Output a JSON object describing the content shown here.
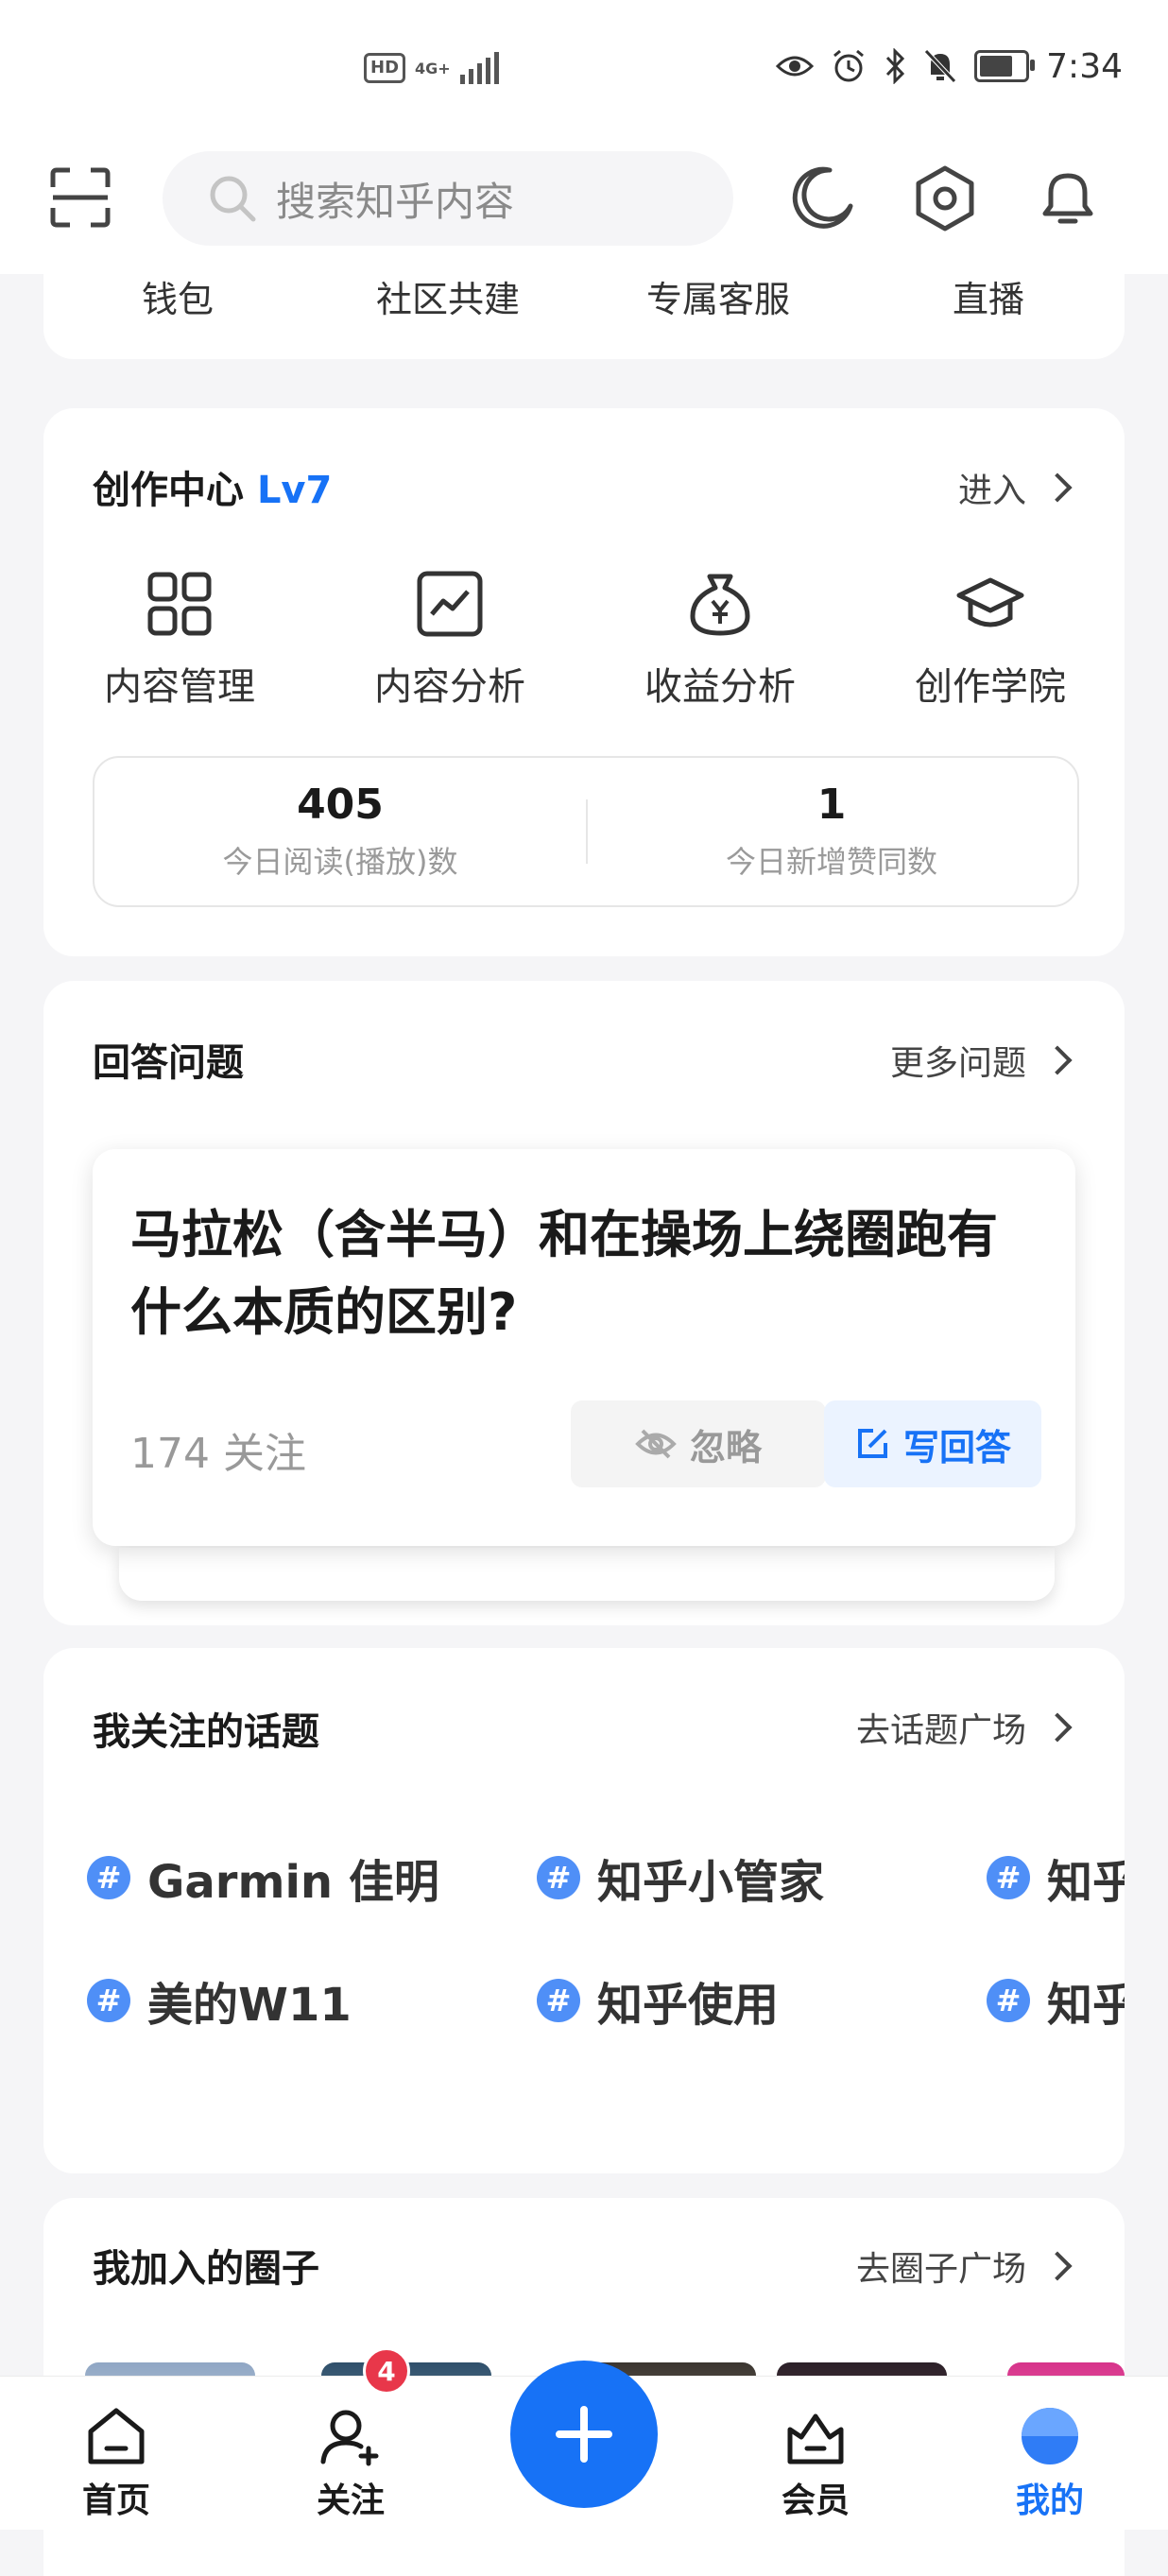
{
  "status_bar": {
    "hd": "HD",
    "network": "4G+",
    "time": "7:34",
    "battery_level": 0.75
  },
  "header": {
    "search_placeholder": "搜索知乎内容"
  },
  "quick_links": [
    "钱包",
    "社区共建",
    "专属客服",
    "直播"
  ],
  "creation_center": {
    "title": "创作中心",
    "level": "Lv7",
    "enter_label": "进入",
    "tools": [
      {
        "label": "内容管理",
        "icon": "grid-icon"
      },
      {
        "label": "内容分析",
        "icon": "chart-line-icon"
      },
      {
        "label": "收益分析",
        "icon": "money-bag-icon"
      },
      {
        "label": "创作学院",
        "icon": "graduation-cap-icon"
      }
    ],
    "stats": [
      {
        "value": "405",
        "label": "今日阅读(播放)数"
      },
      {
        "value": "1",
        "label": "今日新增赞同数"
      }
    ]
  },
  "answer_questions": {
    "title": "回答问题",
    "more_label": "更多问题",
    "question": {
      "text": "马拉松（含半马）和在操场上绕圈跑有什么本质的区别?",
      "followers": "174 关注",
      "ignore_label": "忽略",
      "write_label": "写回答"
    }
  },
  "topics": {
    "title": "我关注的话题",
    "more_label": "去话题广场",
    "items": [
      "Garmin 佳明",
      "知乎小管家",
      "知乎",
      "美的W11",
      "知乎使用",
      "知乎"
    ]
  },
  "circles": {
    "title": "我加入的圈子",
    "more_label": "去圈子广场"
  },
  "bottom_nav": {
    "items": [
      {
        "label": "首页",
        "icon": "home-icon"
      },
      {
        "label": "关注",
        "icon": "follow-icon"
      },
      {
        "label": "会员",
        "icon": "vip-icon"
      },
      {
        "label": "我的",
        "icon": "profile-icon"
      }
    ],
    "follow_badge": "4",
    "active_index": 3
  },
  "colors": {
    "accent": "#1772f6",
    "badge": "#e8374a",
    "background": "#f5f5f7"
  }
}
